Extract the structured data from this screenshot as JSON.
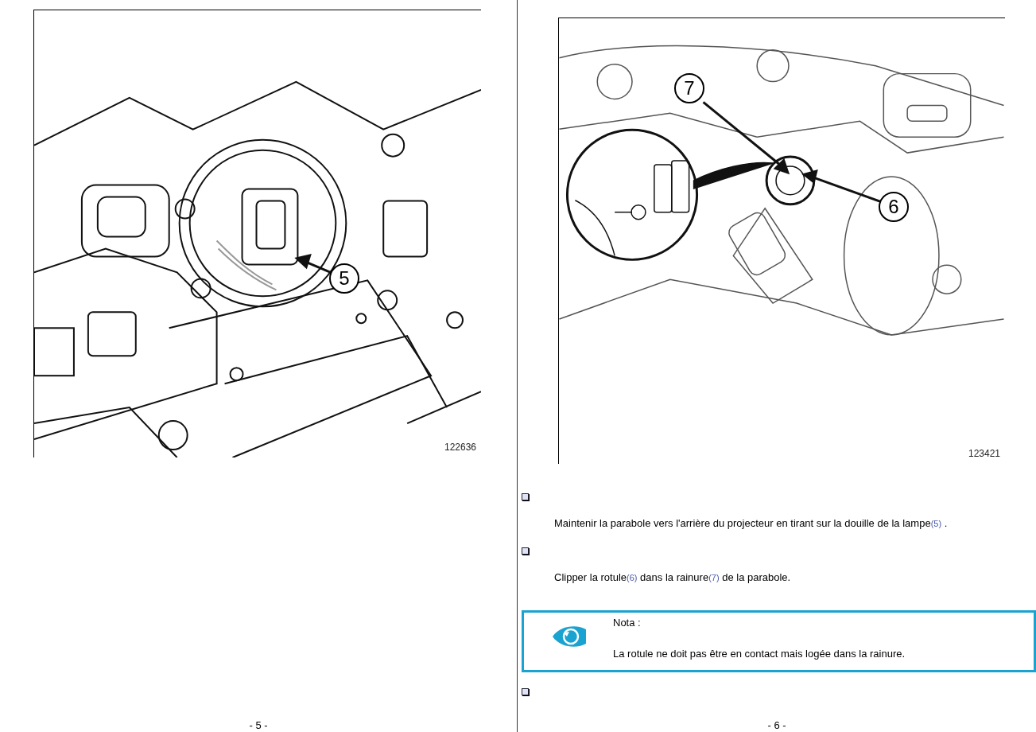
{
  "pages": [
    {
      "figure": {
        "callouts": [
          {
            "label": "5"
          }
        ],
        "number": "122636"
      },
      "page_number": "- 5 -"
    },
    {
      "figure": {
        "callouts": [
          {
            "label": "7"
          },
          {
            "label": "6"
          }
        ],
        "number": "123421"
      },
      "content": [
        {
          "kind": "step"
        },
        {
          "kind": "text",
          "parts": [
            {
              "kind": "plain",
              "text": "Maintenir la parabole vers l'arrière du projecteur en tirant sur la douille de la lampe"
            },
            {
              "kind": "ref",
              "text": "(5)"
            },
            {
              "kind": "plain",
              "text": " ."
            }
          ]
        },
        {
          "kind": "step"
        },
        {
          "kind": "text",
          "parts": [
            {
              "kind": "plain",
              "text": "Clipper la rotule"
            },
            {
              "kind": "ref",
              "text": "(6)"
            },
            {
              "kind": "plain",
              "text": " dans la rainure"
            },
            {
              "kind": "ref",
              "text": "(7)"
            },
            {
              "kind": "plain",
              "text": " de la parabole."
            }
          ]
        },
        {
          "kind": "note",
          "title": "Nota :",
          "text": "La rotule ne doit pas être en contact mais logée dans la rainure."
        },
        {
          "kind": "step"
        }
      ],
      "page_number": "- 6 -"
    }
  ]
}
